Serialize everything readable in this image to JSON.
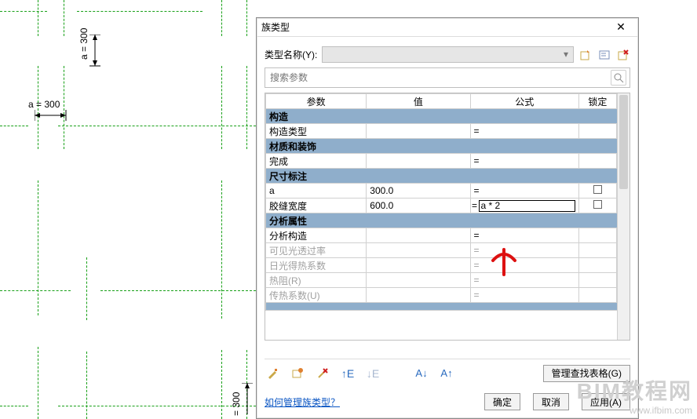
{
  "cad": {
    "dim_h_label": "a = 300",
    "dim_v_label": "a = 300"
  },
  "dialog": {
    "title": "族类型",
    "type_name_label": "类型名称(Y):",
    "type_name_value": "",
    "search_placeholder": "搜索参数",
    "columns": {
      "param": "参数",
      "value": "值",
      "formula": "公式",
      "lock": "锁定"
    },
    "groups": [
      {
        "name": "构造",
        "rows": [
          {
            "param": "构造类型",
            "value": "",
            "formula": "=",
            "lock": false,
            "disabled": false
          }
        ]
      },
      {
        "name": "材质和装饰",
        "rows": [
          {
            "param": "完成",
            "value": "",
            "formula": "=",
            "lock": false,
            "disabled": false
          }
        ]
      },
      {
        "name": "尺寸标注",
        "rows": [
          {
            "param": "a",
            "value": "300.0",
            "formula": "=",
            "lock": false,
            "disabled": false,
            "lockbox": true
          },
          {
            "param": "胶缝宽度",
            "value": "600.0",
            "formula": "a * 2",
            "formula_prefix": "=",
            "lock": false,
            "disabled": false,
            "lockbox": true,
            "active": true
          }
        ]
      },
      {
        "name": "分析属性",
        "rows": [
          {
            "param": "分析构造",
            "value": "",
            "formula": "=",
            "lock": false,
            "disabled": false
          },
          {
            "param": "可见光透过率",
            "value": "",
            "formula": "=",
            "lock": false,
            "disabled": true
          },
          {
            "param": "日光得热系数",
            "value": "",
            "formula": "=",
            "lock": false,
            "disabled": true
          },
          {
            "param": "热阻(R)",
            "value": "",
            "formula": "=",
            "lock": false,
            "disabled": true
          },
          {
            "param": "传热系数(U)",
            "value": "",
            "formula": "=",
            "lock": false,
            "disabled": true
          }
        ]
      }
    ],
    "manage_lookup": "管理查找表格(G)",
    "how_manage": "如何管理族类型？",
    "ok": "确定",
    "cancel": "取消",
    "apply": "应用(A)"
  },
  "watermark": {
    "big": "BIM教程网",
    "small": "www.ifbim.com"
  }
}
